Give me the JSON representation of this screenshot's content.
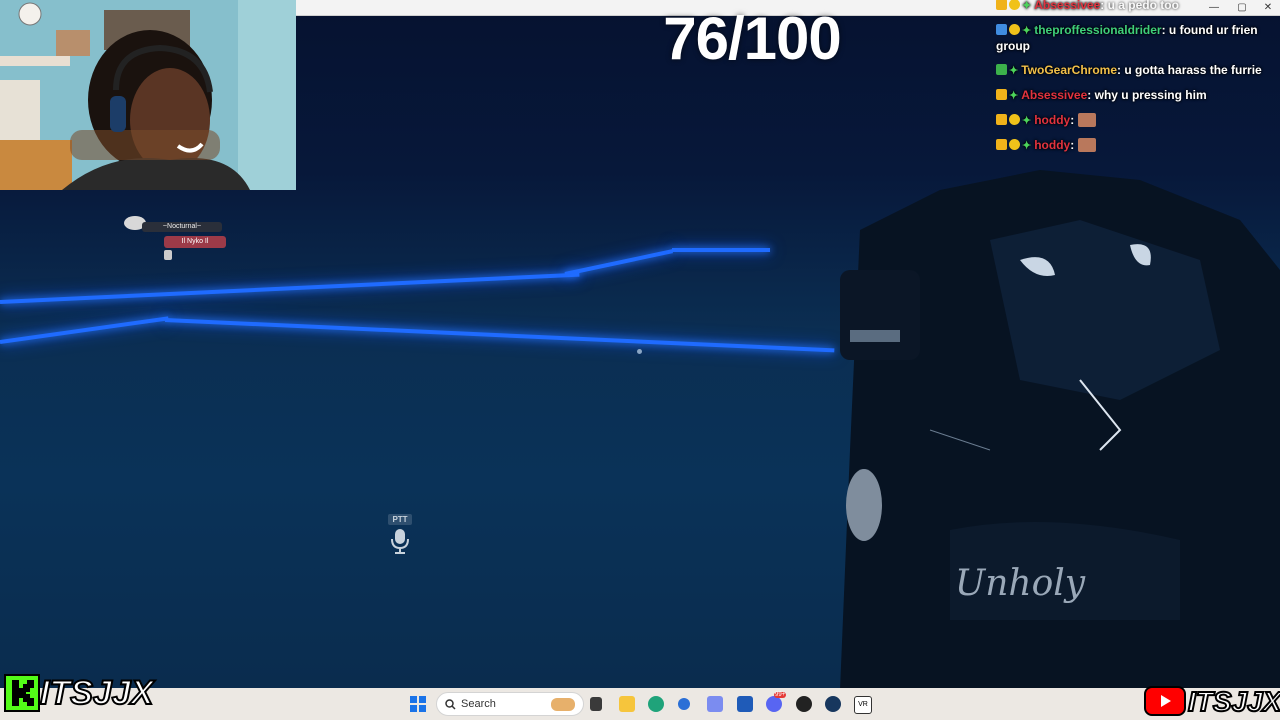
{
  "overlay": {
    "counter": "76/100"
  },
  "chat": {
    "messages": [
      {
        "user": "Absessivee",
        "user_color": "#e2333f",
        "text": "u a pedo too",
        "badges": [
          "crown",
          "gold",
          "star"
        ]
      },
      {
        "user": "theproffessionaldrider",
        "user_color": "#3fcf7a",
        "text": "u found ur frien group",
        "badges": [
          "blue",
          "gold",
          "star"
        ]
      },
      {
        "user": "TwoGearChrome",
        "user_color": "#f2c04a",
        "text": "u gotta harass the furrie",
        "badges": [
          "sub",
          "star"
        ]
      },
      {
        "user": "Absessivee",
        "user_color": "#e2333f",
        "text": "why u pressing him",
        "badges": [
          "crown",
          "star"
        ]
      },
      {
        "user": "hoddy",
        "user_color": "#e2333f",
        "text": "",
        "badges": [
          "crown",
          "gold",
          "star"
        ],
        "emote": true
      },
      {
        "user": "hoddy",
        "user_color": "#e2333f",
        "text": "",
        "badges": [
          "crown",
          "gold",
          "star"
        ],
        "emote": true
      }
    ]
  },
  "vr": {
    "ptt_label": "PTT",
    "nametag_primary": "~Nocturnal~",
    "nametag_secondary": "Il Nyko Il"
  },
  "avatar": {
    "shirt_text": "Unholy"
  },
  "window": {
    "minimize": "—",
    "maximize": "▢",
    "close": "✕"
  },
  "taskbar": {
    "search_placeholder": "Search",
    "discord_badge": "99+"
  },
  "branding": {
    "kick_handle": "ITSJJX",
    "youtube_handle": "ITSJJX"
  },
  "colors": {
    "neon": "#1f6bff",
    "kick_green": "#53fc18",
    "youtube_red": "#ff0000"
  }
}
